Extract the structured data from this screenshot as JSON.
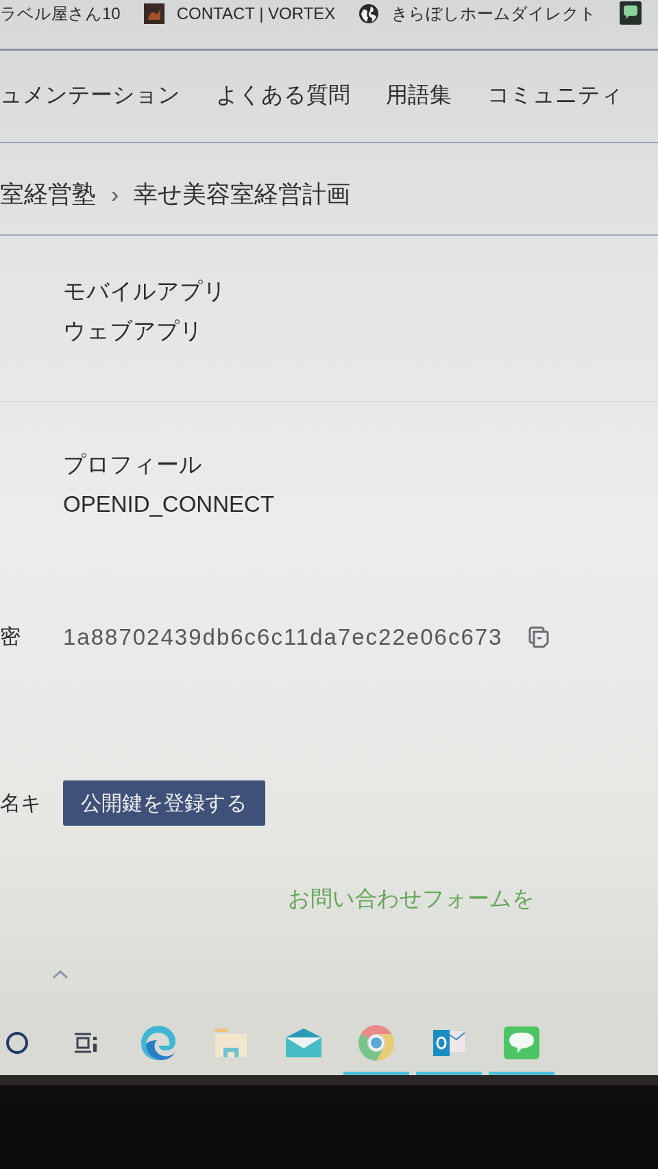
{
  "bookmarks": [
    {
      "kind": "text",
      "label": "ラベル屋さん10"
    },
    {
      "kind": "thumb",
      "label": "CONTACT | VORTEX"
    },
    {
      "kind": "globe",
      "label": "きらぼしホームダイレクト"
    },
    {
      "kind": "chat"
    }
  ],
  "nav": {
    "items": [
      {
        "label": "ュメンテーション"
      },
      {
        "label": "よくある質問"
      },
      {
        "label": "用語集"
      },
      {
        "label": "コミュニティ"
      }
    ]
  },
  "breadcrumb": {
    "items": [
      "室経営塾",
      "幸せ美容室経営計画"
    ],
    "separator": "›"
  },
  "sections": [
    {
      "kind": "list",
      "values": [
        "モバイルアプリ",
        "ウェブアプリ"
      ]
    },
    {
      "kind": "list",
      "values": [
        "プロフィール",
        "OPENID_CONNECT"
      ]
    },
    {
      "kind": "secret",
      "label": "密",
      "value": "1a88702439db6c6c11da7ec22e06c673"
    },
    {
      "kind": "action",
      "label": "名キ",
      "button": "公開鍵を登録する"
    }
  ],
  "contact_link": "お問い合わせフォームを",
  "taskbar": {
    "items": [
      {
        "kind": "search",
        "running": false
      },
      {
        "kind": "tasks",
        "running": false
      },
      {
        "kind": "swirl",
        "running": false
      },
      {
        "kind": "folder",
        "running": false
      },
      {
        "kind": "mail",
        "running": false
      },
      {
        "kind": "ring",
        "running": true
      },
      {
        "kind": "o_mail",
        "running": true
      },
      {
        "kind": "chat",
        "running": true
      }
    ]
  }
}
